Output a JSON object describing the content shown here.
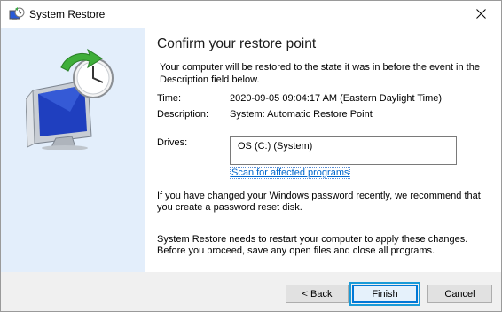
{
  "window": {
    "title": "System Restore"
  },
  "heading": "Confirm your restore point",
  "intro": "Your computer will be restored to the state it was in before the event in the Description field below.",
  "fields": {
    "time_label": "Time:",
    "time_value": "2020-09-05 09:04:17 AM (Eastern Daylight Time)",
    "description_label": "Description:",
    "description_value": "System: Automatic Restore Point",
    "drives_label": "Drives:",
    "drives_items": [
      "OS (C:) (System)"
    ]
  },
  "scan_link": "Scan for affected programs",
  "password_note": "If you have changed your Windows password recently, we recommend that you create a password reset disk.",
  "restart_note": "System Restore needs to restart your computer to apply these changes. Before you proceed, save any open files and close all programs.",
  "buttons": {
    "back": "< Back",
    "finish": "Finish",
    "cancel": "Cancel"
  },
  "icons": {
    "title": "system-restore-icon",
    "close": "close-icon",
    "hero": "restore-monitor-clock-icon"
  },
  "colors": {
    "left_panel": "#e3eefb",
    "link": "#0066cc",
    "highlight": "#1a9bd7"
  }
}
